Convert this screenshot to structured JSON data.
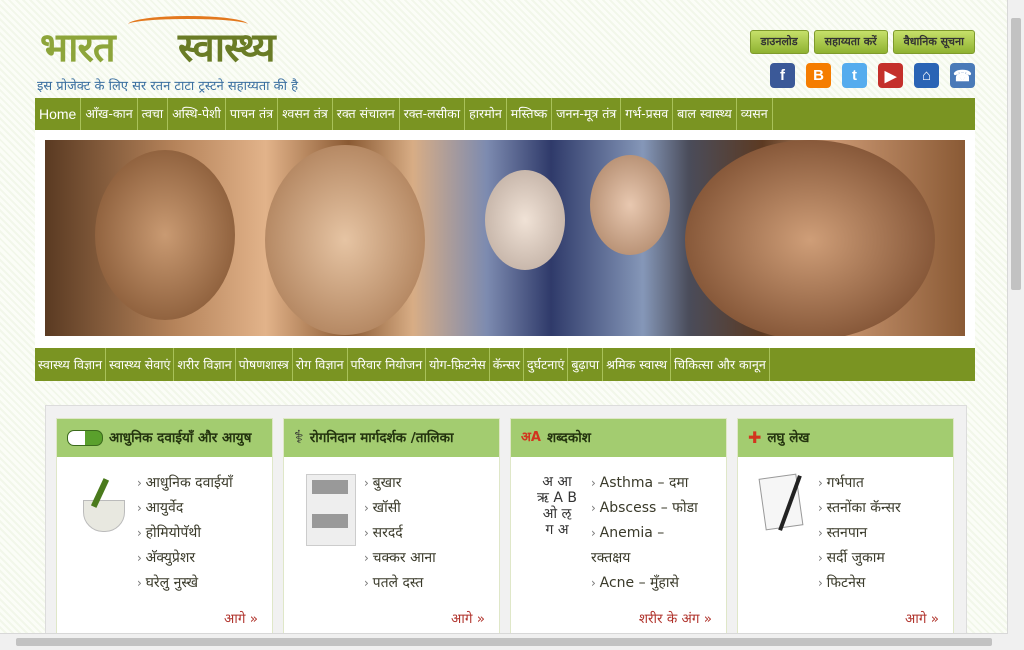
{
  "header": {
    "logo_part1": "भारत",
    "logo_part2": "स्वास्थ्य",
    "tagline": "इस प्रोजेक्ट के लिए सर रतन टाटा ट्रस्टने सहाय्यता की है",
    "buttons": [
      "डाउनलोड",
      "सहाय्यता करें",
      "वैधानिक सूचना"
    ]
  },
  "social": [
    {
      "name": "facebook-icon",
      "glyph": "f",
      "color": "#3b5998"
    },
    {
      "name": "blogger-icon",
      "glyph": "B",
      "color": "#f57d00"
    },
    {
      "name": "twitter-icon",
      "glyph": "t",
      "color": "#55acee"
    },
    {
      "name": "youtube-icon",
      "glyph": "▶",
      "color": "#c4302b"
    },
    {
      "name": "home-icon",
      "glyph": "⌂",
      "color": "#2a64b5"
    },
    {
      "name": "phone-icon",
      "glyph": "☎",
      "color": "#4a7ab8"
    }
  ],
  "nav": [
    "Home",
    "आँख-कान",
    "त्वचा",
    "अस्थि-पेशी",
    "पाचन तंत्र",
    "श्वसन तंत्र",
    "रक्त संचालन",
    "रक्त-लसीका",
    "हारमोन",
    "मस्तिष्क",
    "जनन-मूत्र तंत्र",
    "गर्भ-प्रसव",
    "बाल स्वास्थ्य",
    "व्यसन"
  ],
  "nav2": [
    "स्वास्थ्य विज्ञान",
    "स्वास्थ्य सेवाएं",
    "शरीर विज्ञान",
    "पोषणशास्त्र",
    "रोग विज्ञान",
    "परिवार नियोजन",
    "योग-फ़िटनेस",
    "कॅन्सर",
    "दुर्घटनाएं",
    "बुढ़ापा",
    "श्रमिक स्वास्थ",
    "चिकित्सा और कानून"
  ],
  "cards": [
    {
      "title": "आधुनिक दवाईयाँ और आयुष",
      "items": [
        "आधुनिक दवाईयाँ",
        "आयुर्वेद",
        "होमियोपॅथी",
        "अ‍ॅक्युप्रेशर",
        "घरेलु नुस्खे"
      ],
      "more": "आगे »"
    },
    {
      "title": "रोगनिदान मार्गदर्शक /तालिका",
      "items": [
        "बुखार",
        "खॉसी",
        "सरदर्द",
        "चक्कर आना",
        "पतले दस्त"
      ],
      "more": "आगे »"
    },
    {
      "title": "शब्दकोश",
      "items": [
        "Asthma – दमा",
        "Abscess – फोडा",
        "Anemia – रक्तक्षय",
        "Acne – मुँहासे"
      ],
      "more": "शरीर के अंग »"
    },
    {
      "title": "लघु लेख",
      "items": [
        "गर्भपात",
        "स्तनोंका कॅन्सर",
        "स्तनपान",
        "सर्दी जुकाम",
        "फिटनेस"
      ],
      "more": "आगे »"
    }
  ]
}
